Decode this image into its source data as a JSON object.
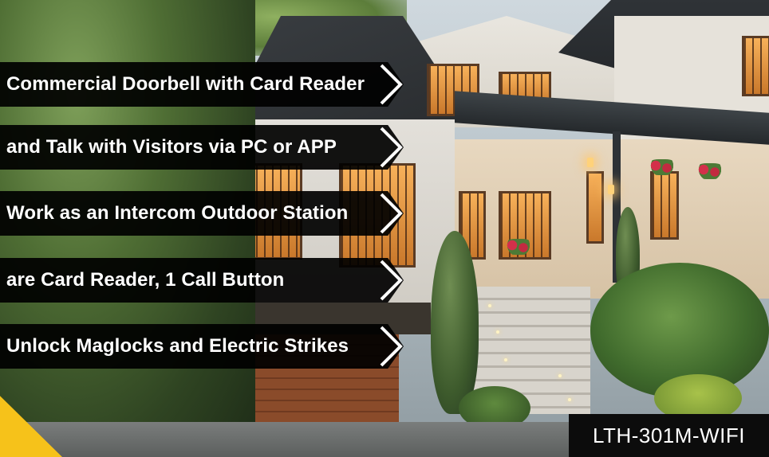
{
  "features": [
    {
      "text": "Commercial Doorbell with Card Reader"
    },
    {
      "text": "and Talk with Visitors via PC or APP"
    },
    {
      "text": "Work as an Intercom Outdoor Station"
    },
    {
      "text": "are Card Reader, 1 Call Button"
    },
    {
      "text": "Unlock Maglocks and Electric Strikes"
    }
  ],
  "model": "LTH-301M-WIFI",
  "colors": {
    "banner_bg": "#000000",
    "banner_text": "#ffffff",
    "chevron_stroke": "#ffffff",
    "accent": "#f6c21a",
    "model_bg": "#0c0c0c"
  }
}
